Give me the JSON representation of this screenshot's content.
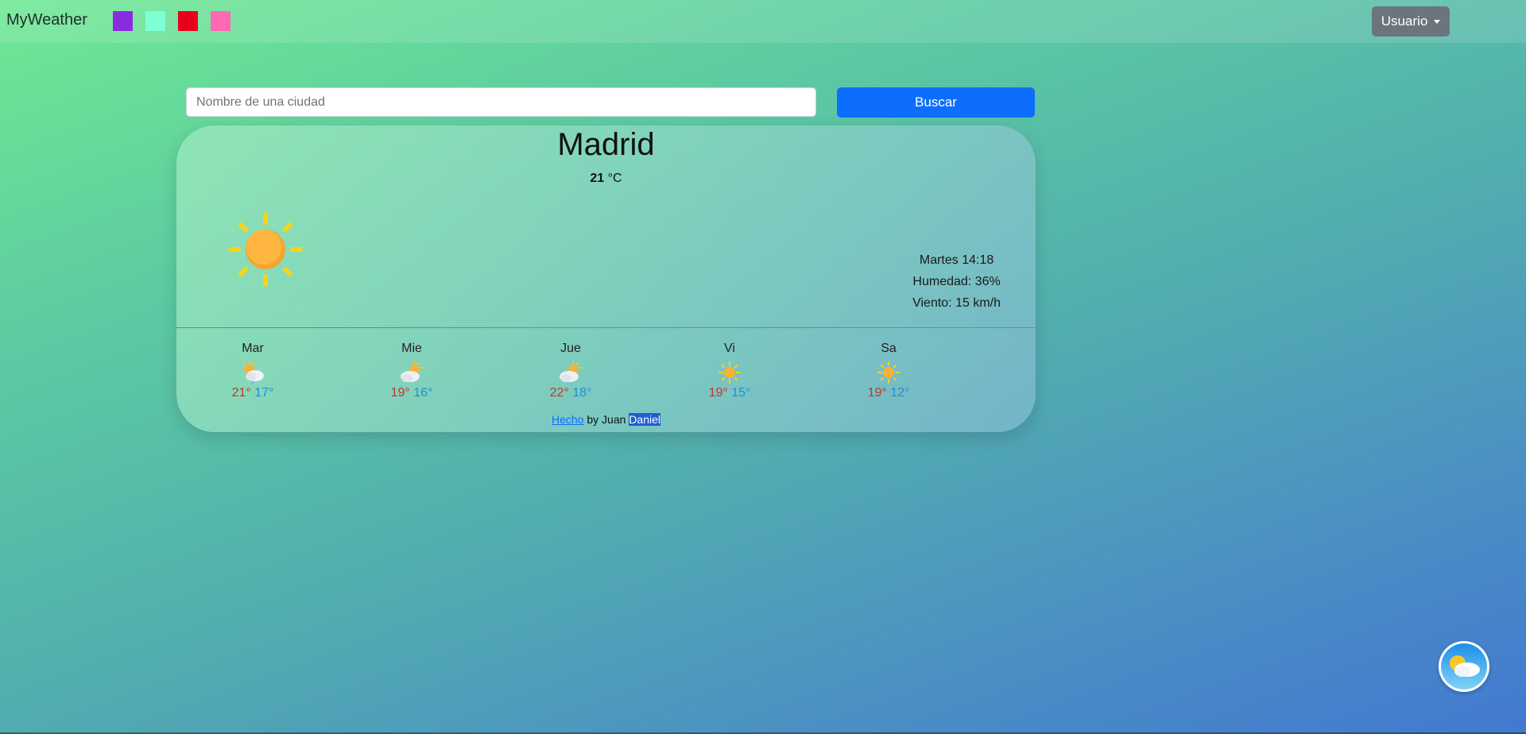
{
  "navbar": {
    "brand": "MyWeather",
    "swatches": [
      {
        "name": "purple",
        "color": "#8a2be2"
      },
      {
        "name": "aquamarine",
        "color": "#7fffd4"
      },
      {
        "name": "red",
        "color": "#e8001c"
      },
      {
        "name": "pink",
        "color": "#ff69b4"
      }
    ],
    "user_menu": "Usuario"
  },
  "search": {
    "placeholder": "Nombre de una ciudad",
    "button": "Buscar"
  },
  "current": {
    "city": "Madrid",
    "temperature": "21",
    "unit": "°C",
    "icon": "sun-icon",
    "day_time": "Martes 14:18",
    "humidity": "Humedad: 36%",
    "wind": "Viento: 15 km/h"
  },
  "forecast": [
    {
      "day": "Mar",
      "icon": "partly-cloudy-rain-icon",
      "high": "21°",
      "low": "17°"
    },
    {
      "day": "Mie",
      "icon": "partly-cloudy-icon",
      "high": "19°",
      "low": "16°"
    },
    {
      "day": "Jue",
      "icon": "partly-cloudy-icon",
      "high": "22°",
      "low": "18°"
    },
    {
      "day": "Vi",
      "icon": "sun-icon",
      "high": "19°",
      "low": "15°"
    },
    {
      "day": "Sa",
      "icon": "sun-icon",
      "high": "19°",
      "low": "12°"
    }
  ],
  "footer": {
    "link": "Hecho",
    "text": " by Juan ",
    "highlighted": "Daniel"
  },
  "colors": {
    "accent": "#0d6efd",
    "high_temp": "#c0392b",
    "low_temp": "#1d8fd6",
    "user_button": "#6c757d"
  }
}
